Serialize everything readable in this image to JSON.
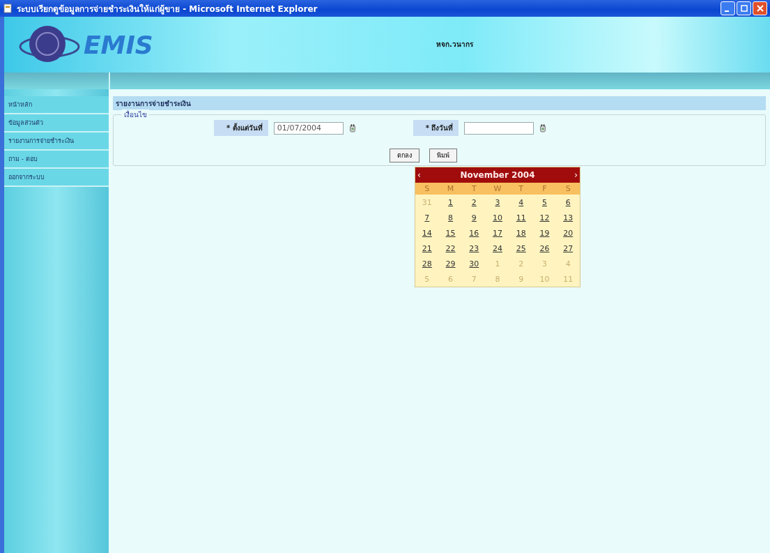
{
  "window": {
    "title": "ระบบเรียกดูข้อมูลการจ่ายชำระเงินให้แก่ผู้ขาย - Microsoft Internet Explorer"
  },
  "banner": {
    "logo": "EMIS",
    "user": "หจก.วนากร"
  },
  "sidebar": {
    "items": [
      {
        "label": "หน้าหลัก"
      },
      {
        "label": "ข้อมูลส่วนตัว"
      },
      {
        "label": "รายงานการจ่ายชำระเงิน"
      },
      {
        "label": "ถาม - ตอบ"
      },
      {
        "label": "ออกจากระบบ"
      }
    ]
  },
  "section_title": "รายงานการจ่ายชำระเงิน",
  "form": {
    "legend": "เงื่อนไข",
    "fields": [
      {
        "label": "* ตั้งแต่วันที่",
        "value": "01/07/2004"
      },
      {
        "label": "* ถึงวันที่"
      }
    ],
    "buttons": [
      "ตกลง",
      "พิมพ์"
    ]
  },
  "calendar": {
    "prev": "‹",
    "title": "November 2004",
    "next": "›",
    "weekdays": [
      "S",
      "M",
      "T",
      "W",
      "T",
      "F",
      "S"
    ],
    "weeks": [
      [
        {
          "day": "31",
          "other": true
        },
        {
          "day": "1",
          "other": false
        },
        {
          "day": "2",
          "other": false
        },
        {
          "day": "3",
          "other": false
        },
        {
          "day": "4",
          "other": false
        },
        {
          "day": "5",
          "other": false
        },
        {
          "day": "6",
          "other": false
        }
      ],
      [
        {
          "day": "7",
          "other": false
        },
        {
          "day": "8",
          "other": false
        },
        {
          "day": "9",
          "other": false
        },
        {
          "day": "10",
          "other": false
        },
        {
          "day": "11",
          "other": false
        },
        {
          "day": "12",
          "other": false
        },
        {
          "day": "13",
          "other": false
        }
      ],
      [
        {
          "day": "14",
          "other": false
        },
        {
          "day": "15",
          "other": false
        },
        {
          "day": "16",
          "other": false
        },
        {
          "day": "17",
          "other": false
        },
        {
          "day": "18",
          "other": false
        },
        {
          "day": "19",
          "other": false
        },
        {
          "day": "20",
          "other": false
        }
      ],
      [
        {
          "day": "21",
          "other": false
        },
        {
          "day": "22",
          "other": false
        },
        {
          "day": "23",
          "other": false
        },
        {
          "day": "24",
          "other": false
        },
        {
          "day": "25",
          "other": false
        },
        {
          "day": "26",
          "other": false
        },
        {
          "day": "27",
          "other": false
        }
      ],
      [
        {
          "day": "28",
          "other": false
        },
        {
          "day": "29",
          "other": false
        },
        {
          "day": "30",
          "other": false
        },
        {
          "day": "1",
          "other": true
        },
        {
          "day": "2",
          "other": true
        },
        {
          "day": "3",
          "other": true
        },
        {
          "day": "4",
          "other": true
        }
      ],
      [
        {
          "day": "5",
          "other": true
        },
        {
          "day": "6",
          "other": true
        },
        {
          "day": "7",
          "other": true
        },
        {
          "day": "8",
          "other": true
        },
        {
          "day": "9",
          "other": true
        },
        {
          "day": "10",
          "other": true
        },
        {
          "day": "11",
          "other": true
        }
      ]
    ]
  }
}
